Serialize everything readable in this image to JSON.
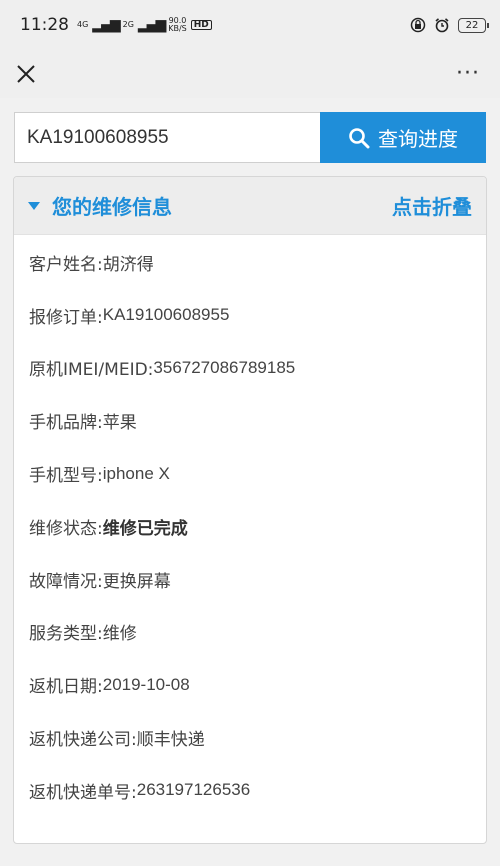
{
  "status_bar": {
    "time": "11:28",
    "net_4g": "4G",
    "net_2g": "2G",
    "speed_value": "90.0",
    "speed_unit": "KB/S",
    "hd": "HD",
    "battery": "22"
  },
  "title_bar": {
    "more": "···"
  },
  "search": {
    "value": "KA19100608955",
    "button_label": "查询进度"
  },
  "panel": {
    "title": "您的维修信息",
    "collapse_label": "点击折叠",
    "rows": [
      {
        "label": "客户姓名:",
        "value": "胡济得"
      },
      {
        "label": "报修订单:",
        "value": "KA19100608955"
      },
      {
        "label": "原机IMEI/MEID:",
        "value": "356727086789185"
      },
      {
        "label": "手机品牌:",
        "value": "苹果"
      },
      {
        "label": "手机型号:",
        "value": "iphone X"
      },
      {
        "label": "维修状态:",
        "value": "维修已完成"
      },
      {
        "label": "故障情况:",
        "value": "更换屏幕"
      },
      {
        "label": "服务类型:",
        "value": "维修"
      },
      {
        "label": "返机日期:",
        "value": "2019-10-08"
      },
      {
        "label": "返机快递公司:",
        "value": "顺丰快递"
      },
      {
        "label": "返机快递单号:",
        "value": "263197126536"
      }
    ]
  },
  "colors": {
    "accent": "#1f8ed9"
  }
}
